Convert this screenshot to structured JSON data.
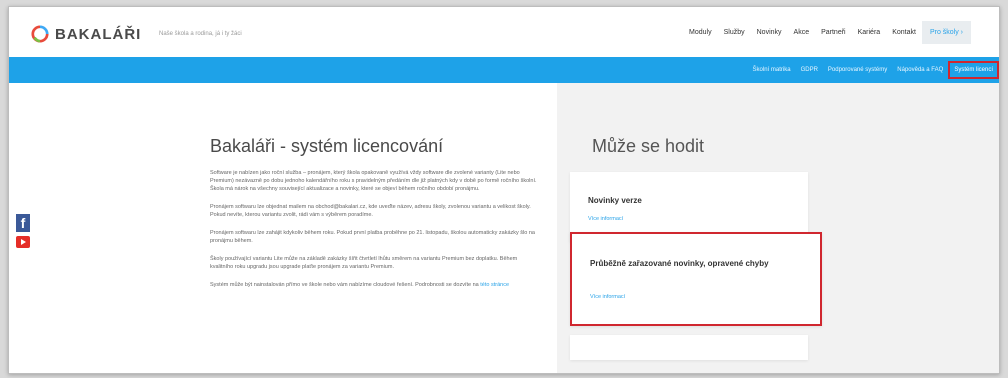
{
  "header": {
    "logo_text": "BAKALÁŘI",
    "tagline": "Naše škola a rodina, já i ty žáci",
    "nav": [
      "Moduly",
      "Služby",
      "Novinky",
      "Akce",
      "Partneři",
      "Kariéra",
      "Kontakt",
      "Pro školy ›"
    ]
  },
  "subnav": {
    "items": [
      "Školní matrika",
      "GDPR",
      "Podporované systémy",
      "Nápověda a FAQ",
      "Systém licencí"
    ]
  },
  "article": {
    "title": "Bakaláři - systém licencování",
    "paragraphs": [
      "Software je nabízen jako roční služba – pronájem, který škola opakovaně využívá vždy software dle zvolené varianty (Lite nebo Premium) nezávazně po dobu jednoho kalendářního roku s pravidelným předáním dle již platných kdy v době po formě ročního školní. Škola má nárok na všechny související aktualizace a novinky, které se objeví během ročního období pronájmu.",
      "Pronájem softwaru lze objednat mailem na obchod@bakalari.cz, kde uveďte název, adresu školy, zvolenou variantu a velikost školy. Pokud nevíte, kterou variantu zvolit, rádi vám s výběrem poradíme.",
      "Pronájem softwaru lze zahájit kdykoliv během roku. Pokud první platba proběhne po 21. listopadu, školou automaticky zakázky šlo na pronájmu během.",
      "Školy používající variantu Lite může na základě zakázky šířit čtvrtletí lhůtu směrem na variantu Premium bez doplatku. Během kvalitního roku upgradu jsou upgrade plaťte pronájem za variantu Premium.",
      "Systém může být nainstalován přímo ve škole nebo vám nabízíme cloudové řešení. Podrobnosti se dozvíte na"
    ],
    "link": "této stránce"
  },
  "sidebar": {
    "title": "Může se hodit",
    "cards": [
      {
        "title": "Novinky verze",
        "link": "Více informací"
      },
      {
        "title": "Průběžně zařazované novinky, opravené chyby",
        "link": "Více informací"
      }
    ]
  },
  "colors": {
    "accent": "#1ea2e8",
    "highlight": "#d0272f"
  }
}
